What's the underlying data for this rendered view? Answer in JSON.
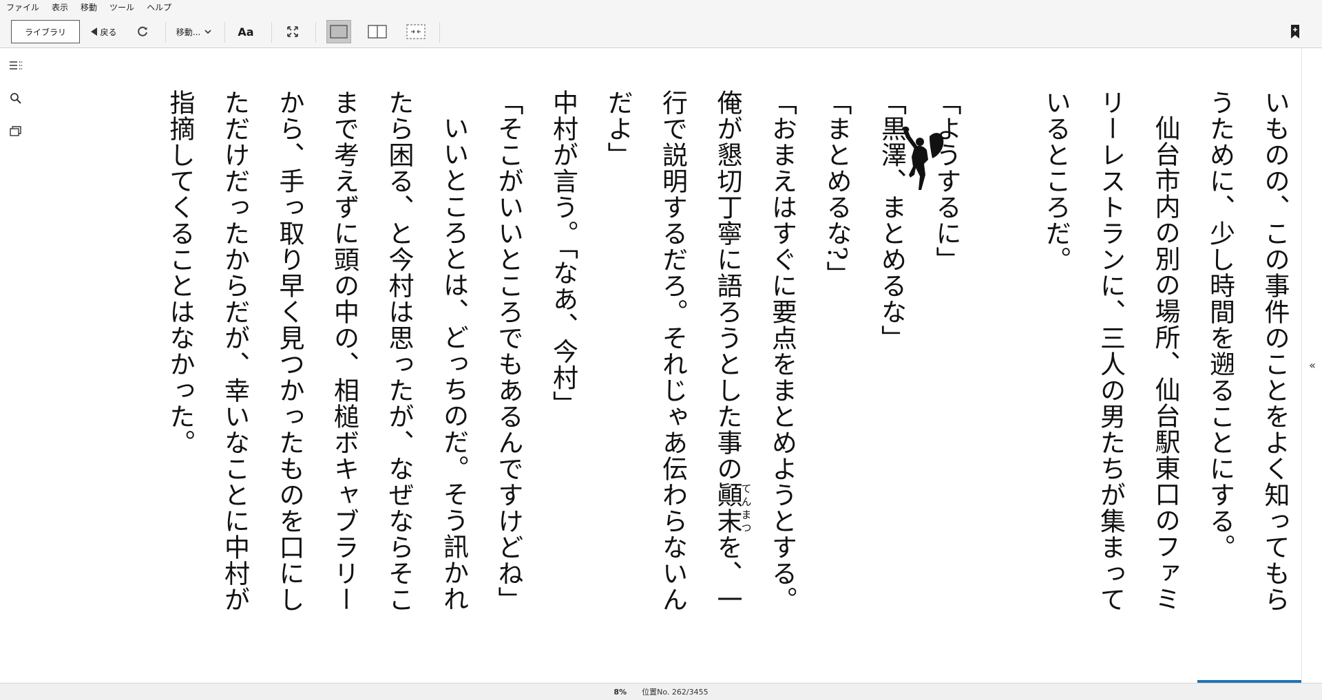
{
  "menu": {
    "file": "ファイル",
    "view": "表示",
    "go": "移動",
    "tools": "ツール",
    "help": "ヘルプ"
  },
  "toolbar": {
    "library": "ライブラリ",
    "back": "戻る",
    "goto": "移動...",
    "font": "Aa"
  },
  "book": {
    "paragraphs": [
      {
        "text": "いものの、この事件のことをよく知ってもらうために、少し時間を遡ることにする。",
        "indent": false
      },
      {
        "text": "仙台市内の別の場所、仙台駅東口のファミリーレストランに、三人の男たちが集まっているところだ。",
        "indent": true
      },
      {
        "text": "",
        "indent": false
      },
      {
        "text": "「ようするに」",
        "indent": false
      },
      {
        "text": "「黒澤、まとめるな」",
        "indent": false
      },
      {
        "text": "「まとめるな?」",
        "indent": false
      },
      {
        "text": "「おまえはすぐに要点をまとめようとする。俺が懇切丁寧に語ろうとした事の",
        "indent": false,
        "ruby_base": "顚末",
        "ruby_text": "てんまつ",
        "tail": "を、一行で説明するだろ。それじゃあ伝わらないんだよ」"
      },
      {
        "text": "中村が言う。「なあ、今村」",
        "indent": false
      },
      {
        "text": "「そこがいいところでもあるんですけどね」",
        "indent": false
      },
      {
        "text": "いいところとは、どっちのだ。そう訊かれたら困る、と今村は思ったが、なぜならそこまで考えずに頭の中の、相槌ボキャブラリーから、手っ取り早く見つかったものを口にしただけだったからだが、幸いなことに中村が指摘してくることはなかった。",
        "indent": true
      }
    ]
  },
  "status": {
    "percent": "8%",
    "location": "位置No. 262/3455",
    "progress": 0.08
  },
  "colors": {
    "accent": "#1f73b7",
    "toolbar_bg": "#f5f5f5"
  }
}
